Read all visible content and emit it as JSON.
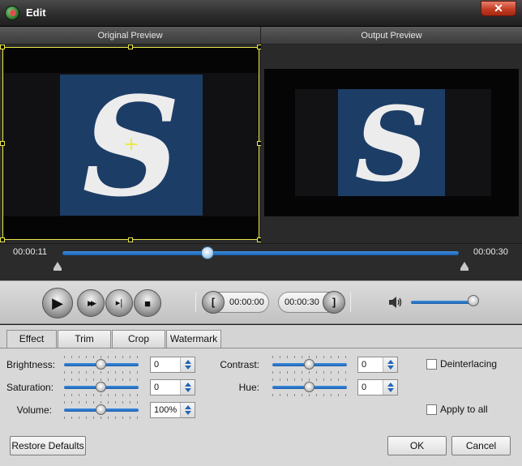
{
  "window": {
    "title": "Edit",
    "close_label": "✕"
  },
  "preview": {
    "original_label": "Original Preview",
    "output_label": "Output Preview",
    "original_logo": "S",
    "output_logo": "S"
  },
  "timeline": {
    "current_time": "00:00:11",
    "total_time": "00:00:30",
    "progress_fraction": 0.366
  },
  "controls": {
    "play_icon": "▶",
    "fast_forward_icon": "▶▶",
    "snapshot_icon": "▸|",
    "stop_icon": "■",
    "start_time": "00:00:00",
    "end_time": "00:00:30",
    "start_bracket": "[",
    "end_bracket": "]",
    "volume_level": 0.9
  },
  "tabs": [
    "Effect",
    "Trim",
    "Crop",
    "Watermark"
  ],
  "active_tab": "Effect",
  "effect": {
    "brightness": {
      "label": "Brightness:",
      "value": "0"
    },
    "saturation": {
      "label": "Saturation:",
      "value": "0"
    },
    "volume": {
      "label": "Volume:",
      "value": "100%"
    },
    "contrast": {
      "label": "Contrast:",
      "value": "0"
    },
    "hue": {
      "label": "Hue:",
      "value": "0"
    },
    "deinterlacing": {
      "label": "Deinterlacing",
      "checked": false
    },
    "apply_to_all": {
      "label": "Apply to all",
      "checked": false
    }
  },
  "buttons": {
    "restore_defaults": "Restore Defaults",
    "ok": "OK",
    "cancel": "Cancel"
  },
  "colors": {
    "accent": "#2a7fd6",
    "crop_border": "#e9e94a",
    "logo_bg": "#1c3d66"
  }
}
